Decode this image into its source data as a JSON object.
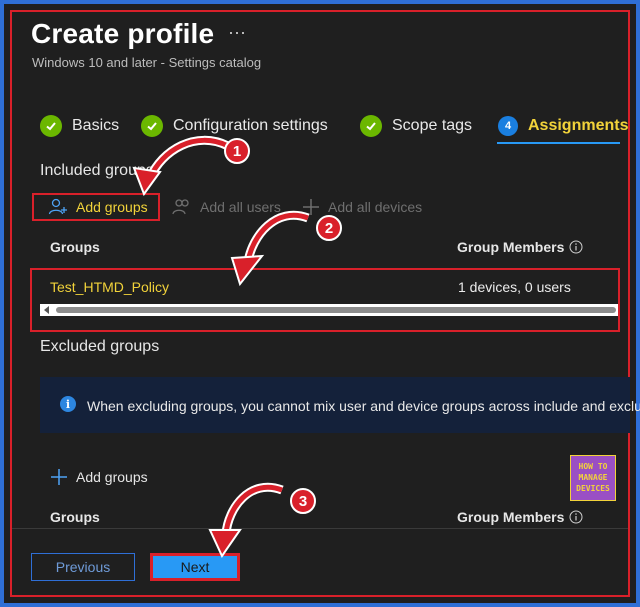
{
  "header": {
    "title": "Create profile",
    "more_label": "···",
    "subtitle": "Windows 10 and later - Settings catalog"
  },
  "tabs": [
    {
      "label": "Basics",
      "status": "complete"
    },
    {
      "label": "Configuration settings",
      "status": "complete"
    },
    {
      "label": "Scope tags",
      "status": "complete"
    },
    {
      "label": "Assignments",
      "status": "active",
      "step": "4"
    }
  ],
  "included": {
    "heading": "Included groups",
    "actions": {
      "add_groups": "Add groups",
      "add_all_users": "Add all users",
      "add_all_devices": "Add all devices"
    },
    "columns": {
      "groups": "Groups",
      "members": "Group Members"
    },
    "rows": [
      {
        "group": "Test_HTMD_Policy",
        "members": "1 devices, 0 users"
      }
    ]
  },
  "excluded": {
    "heading": "Excluded groups",
    "info_icon_text": "i",
    "info_text": "When excluding groups, you cannot mix user and device groups across include and exclude.",
    "add_groups": "Add groups",
    "columns": {
      "groups": "Groups",
      "members": "Group Members"
    }
  },
  "footer": {
    "previous_label": "Previous",
    "next_label": "Next"
  },
  "callouts": [
    "1",
    "2",
    "3"
  ],
  "logo": {
    "line1": "HOW TO",
    "line2": "MANAGE",
    "line3": "DEVICES"
  },
  "colors": {
    "accent_yellow": "#f2d33a",
    "primary_blue": "#2899f5",
    "success_green": "#6bb700",
    "annotation_red": "#d9202a",
    "background": "#1f1f1f"
  }
}
